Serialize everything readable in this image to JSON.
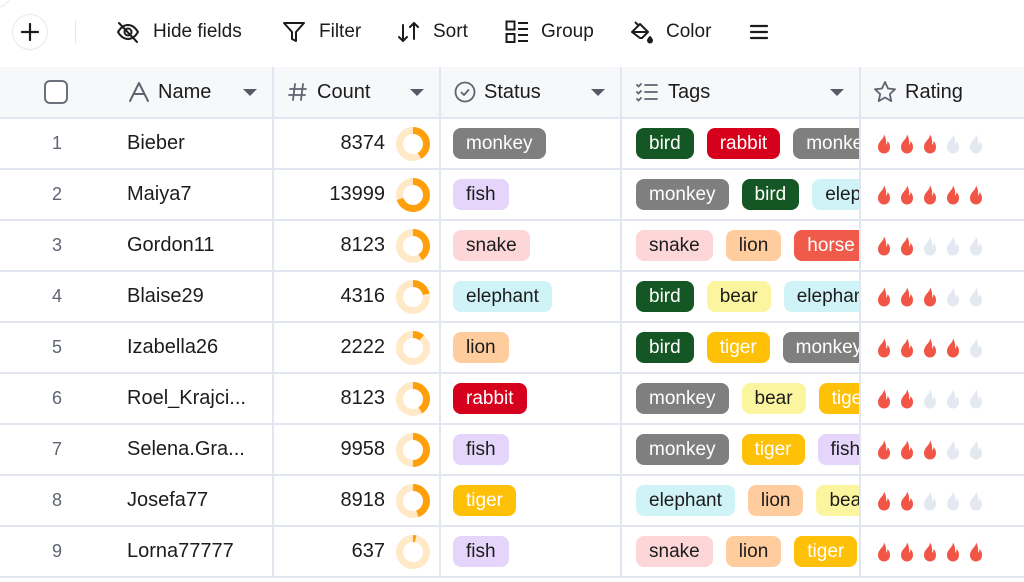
{
  "toolbar": {
    "add_label": "+",
    "items": [
      {
        "label": "Hide fields",
        "icon": "eye-off-icon"
      },
      {
        "label": "Filter",
        "icon": "filter-icon"
      },
      {
        "label": "Sort",
        "icon": "sort-icon"
      },
      {
        "label": "Group",
        "icon": "group-icon"
      },
      {
        "label": "Color",
        "icon": "paint-bucket-icon"
      },
      {
        "label": "",
        "icon": "menu-icon"
      }
    ]
  },
  "columns": [
    {
      "key": "name",
      "label": "Name",
      "icon": "text-type-icon"
    },
    {
      "key": "count",
      "label": "Count",
      "icon": "hash-icon"
    },
    {
      "key": "status",
      "label": "Status",
      "icon": "check-circle-icon"
    },
    {
      "key": "tags",
      "label": "Tags",
      "icon": "checklist-icon"
    },
    {
      "key": "rating",
      "label": "Rating",
      "icon": "star-icon"
    }
  ],
  "count_max": 20000,
  "rating_max": 5,
  "tag_colors": {
    "monkey": {
      "bg": "#7f7f7f",
      "fg": "#ffffff"
    },
    "fish": {
      "bg": "#e6d5fb",
      "fg": "#1c1c1c"
    },
    "snake": {
      "bg": "#fdd6d8",
      "fg": "#1c1c1c"
    },
    "elephant": {
      "bg": "#cff3f7",
      "fg": "#1c1c1c"
    },
    "lion": {
      "bg": "#ffcc9e",
      "fg": "#1c1c1c"
    },
    "rabbit": {
      "bg": "#d6001c",
      "fg": "#ffffff"
    },
    "tiger": {
      "bg": "#ffc107",
      "fg": "#ffffff"
    },
    "bird": {
      "bg": "#155724",
      "fg": "#ffffff"
    },
    "bear": {
      "bg": "#fbf59f",
      "fg": "#1c1c1c"
    },
    "horse": {
      "bg": "#f05a4b",
      "fg": "#ffffff"
    }
  },
  "colors": {
    "donut_fill": "#ff9f0a",
    "donut_track": "#ffe9c7",
    "flame_on": "#f05545",
    "flame_off": "#e3e8f1"
  },
  "rows": [
    {
      "num": "1",
      "name": "Bieber",
      "count": "8374",
      "status": "monkey",
      "tags": [
        "bird",
        "rabbit",
        "monkey"
      ],
      "rating": 3
    },
    {
      "num": "2",
      "name": "Maiya7",
      "count": "13999",
      "status": "fish",
      "tags": [
        "monkey",
        "bird",
        "elephant"
      ],
      "rating": 5
    },
    {
      "num": "3",
      "name": "Gordon11",
      "count": "8123",
      "status": "snake",
      "tags": [
        "snake",
        "lion",
        "horse"
      ],
      "rating": 2
    },
    {
      "num": "4",
      "name": "Blaise29",
      "count": "4316",
      "status": "elephant",
      "tags": [
        "bird",
        "bear",
        "elephant"
      ],
      "rating": 3
    },
    {
      "num": "5",
      "name": "Izabella26",
      "count": "2222",
      "status": "lion",
      "tags": [
        "bird",
        "tiger",
        "monkey"
      ],
      "rating": 4
    },
    {
      "num": "6",
      "name": "Roel_Krajci...",
      "count": "8123",
      "status": "rabbit",
      "tags": [
        "monkey",
        "bear",
        "tiger"
      ],
      "rating": 2
    },
    {
      "num": "7",
      "name": "Selena.Gra...",
      "count": "9958",
      "status": "fish",
      "tags": [
        "monkey",
        "tiger",
        "fish"
      ],
      "rating": 3
    },
    {
      "num": "8",
      "name": "Josefa77",
      "count": "8918",
      "status": "tiger",
      "tags": [
        "elephant",
        "lion",
        "bear"
      ],
      "rating": 2
    },
    {
      "num": "9",
      "name": "Lorna77777",
      "count": "637",
      "status": "fish",
      "tags": [
        "snake",
        "lion",
        "tiger"
      ],
      "rating": 5
    }
  ]
}
